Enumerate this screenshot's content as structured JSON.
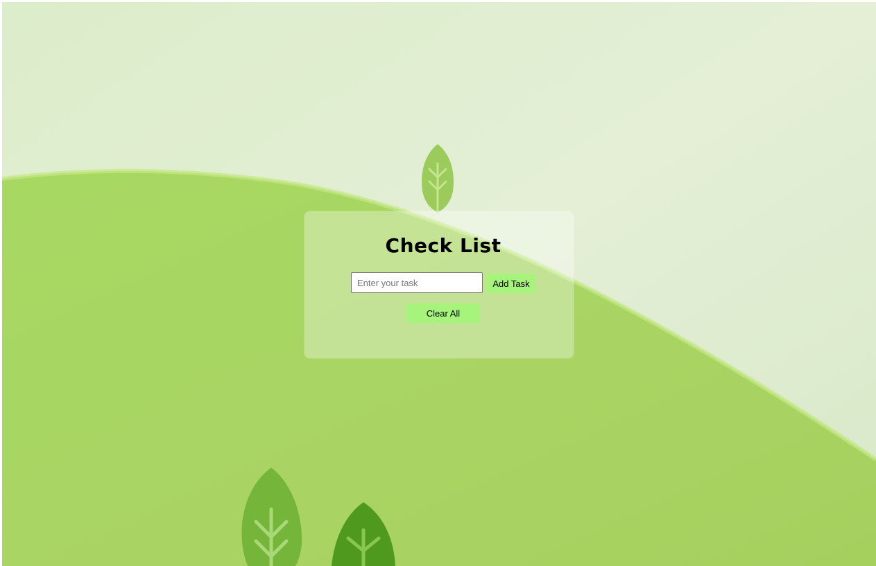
{
  "app": {
    "title": "Check List"
  },
  "task_form": {
    "input_value": "",
    "input_placeholder": "Enter your task",
    "add_button_label": "Add Task"
  },
  "actions": {
    "clear_button_label": "Clear All"
  },
  "tasks": [],
  "colors": {
    "button": "#a6f47c",
    "hill": "#a9d65f",
    "sky": "#e2eed2",
    "leaf_light": "#9bcb5b",
    "leaf_mid": "#75b53a",
    "leaf_dark": "#4f9a1e"
  },
  "background": {
    "icons": [
      "leaf-icon",
      "leaf-icon",
      "leaf-icon"
    ]
  }
}
